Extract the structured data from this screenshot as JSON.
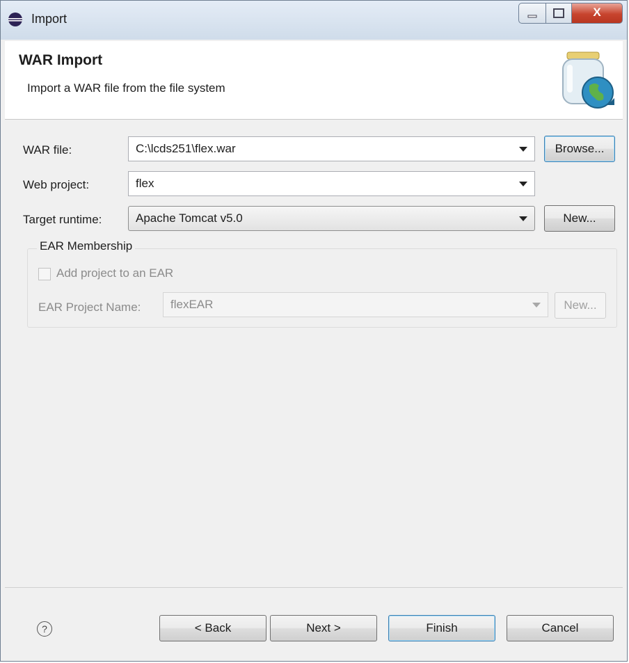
{
  "window": {
    "title": "Import",
    "close_glyph": "X"
  },
  "header": {
    "title": "WAR Import",
    "description": "Import a WAR file from the file system",
    "icon": "war-jar-globe-icon"
  },
  "form": {
    "war_file": {
      "label": "WAR file:",
      "value": "C:\\lcds251\\flex.war",
      "browse_label": "Browse..."
    },
    "web_project": {
      "label": "Web project:",
      "value": "flex"
    },
    "target_runtime": {
      "label": "Target runtime:",
      "value": "Apache Tomcat v5.0",
      "new_label": "New..."
    }
  },
  "ear": {
    "group_label": "EAR Membership",
    "checkbox_label": "Add project to an EAR",
    "checked": false,
    "project_name_label": "EAR Project Name:",
    "project_name_value": "flexEAR",
    "new_label": "New..."
  },
  "footer": {
    "help_glyph": "?",
    "back_label": "< Back",
    "next_label": "Next >",
    "finish_label": "Finish",
    "cancel_label": "Cancel"
  }
}
